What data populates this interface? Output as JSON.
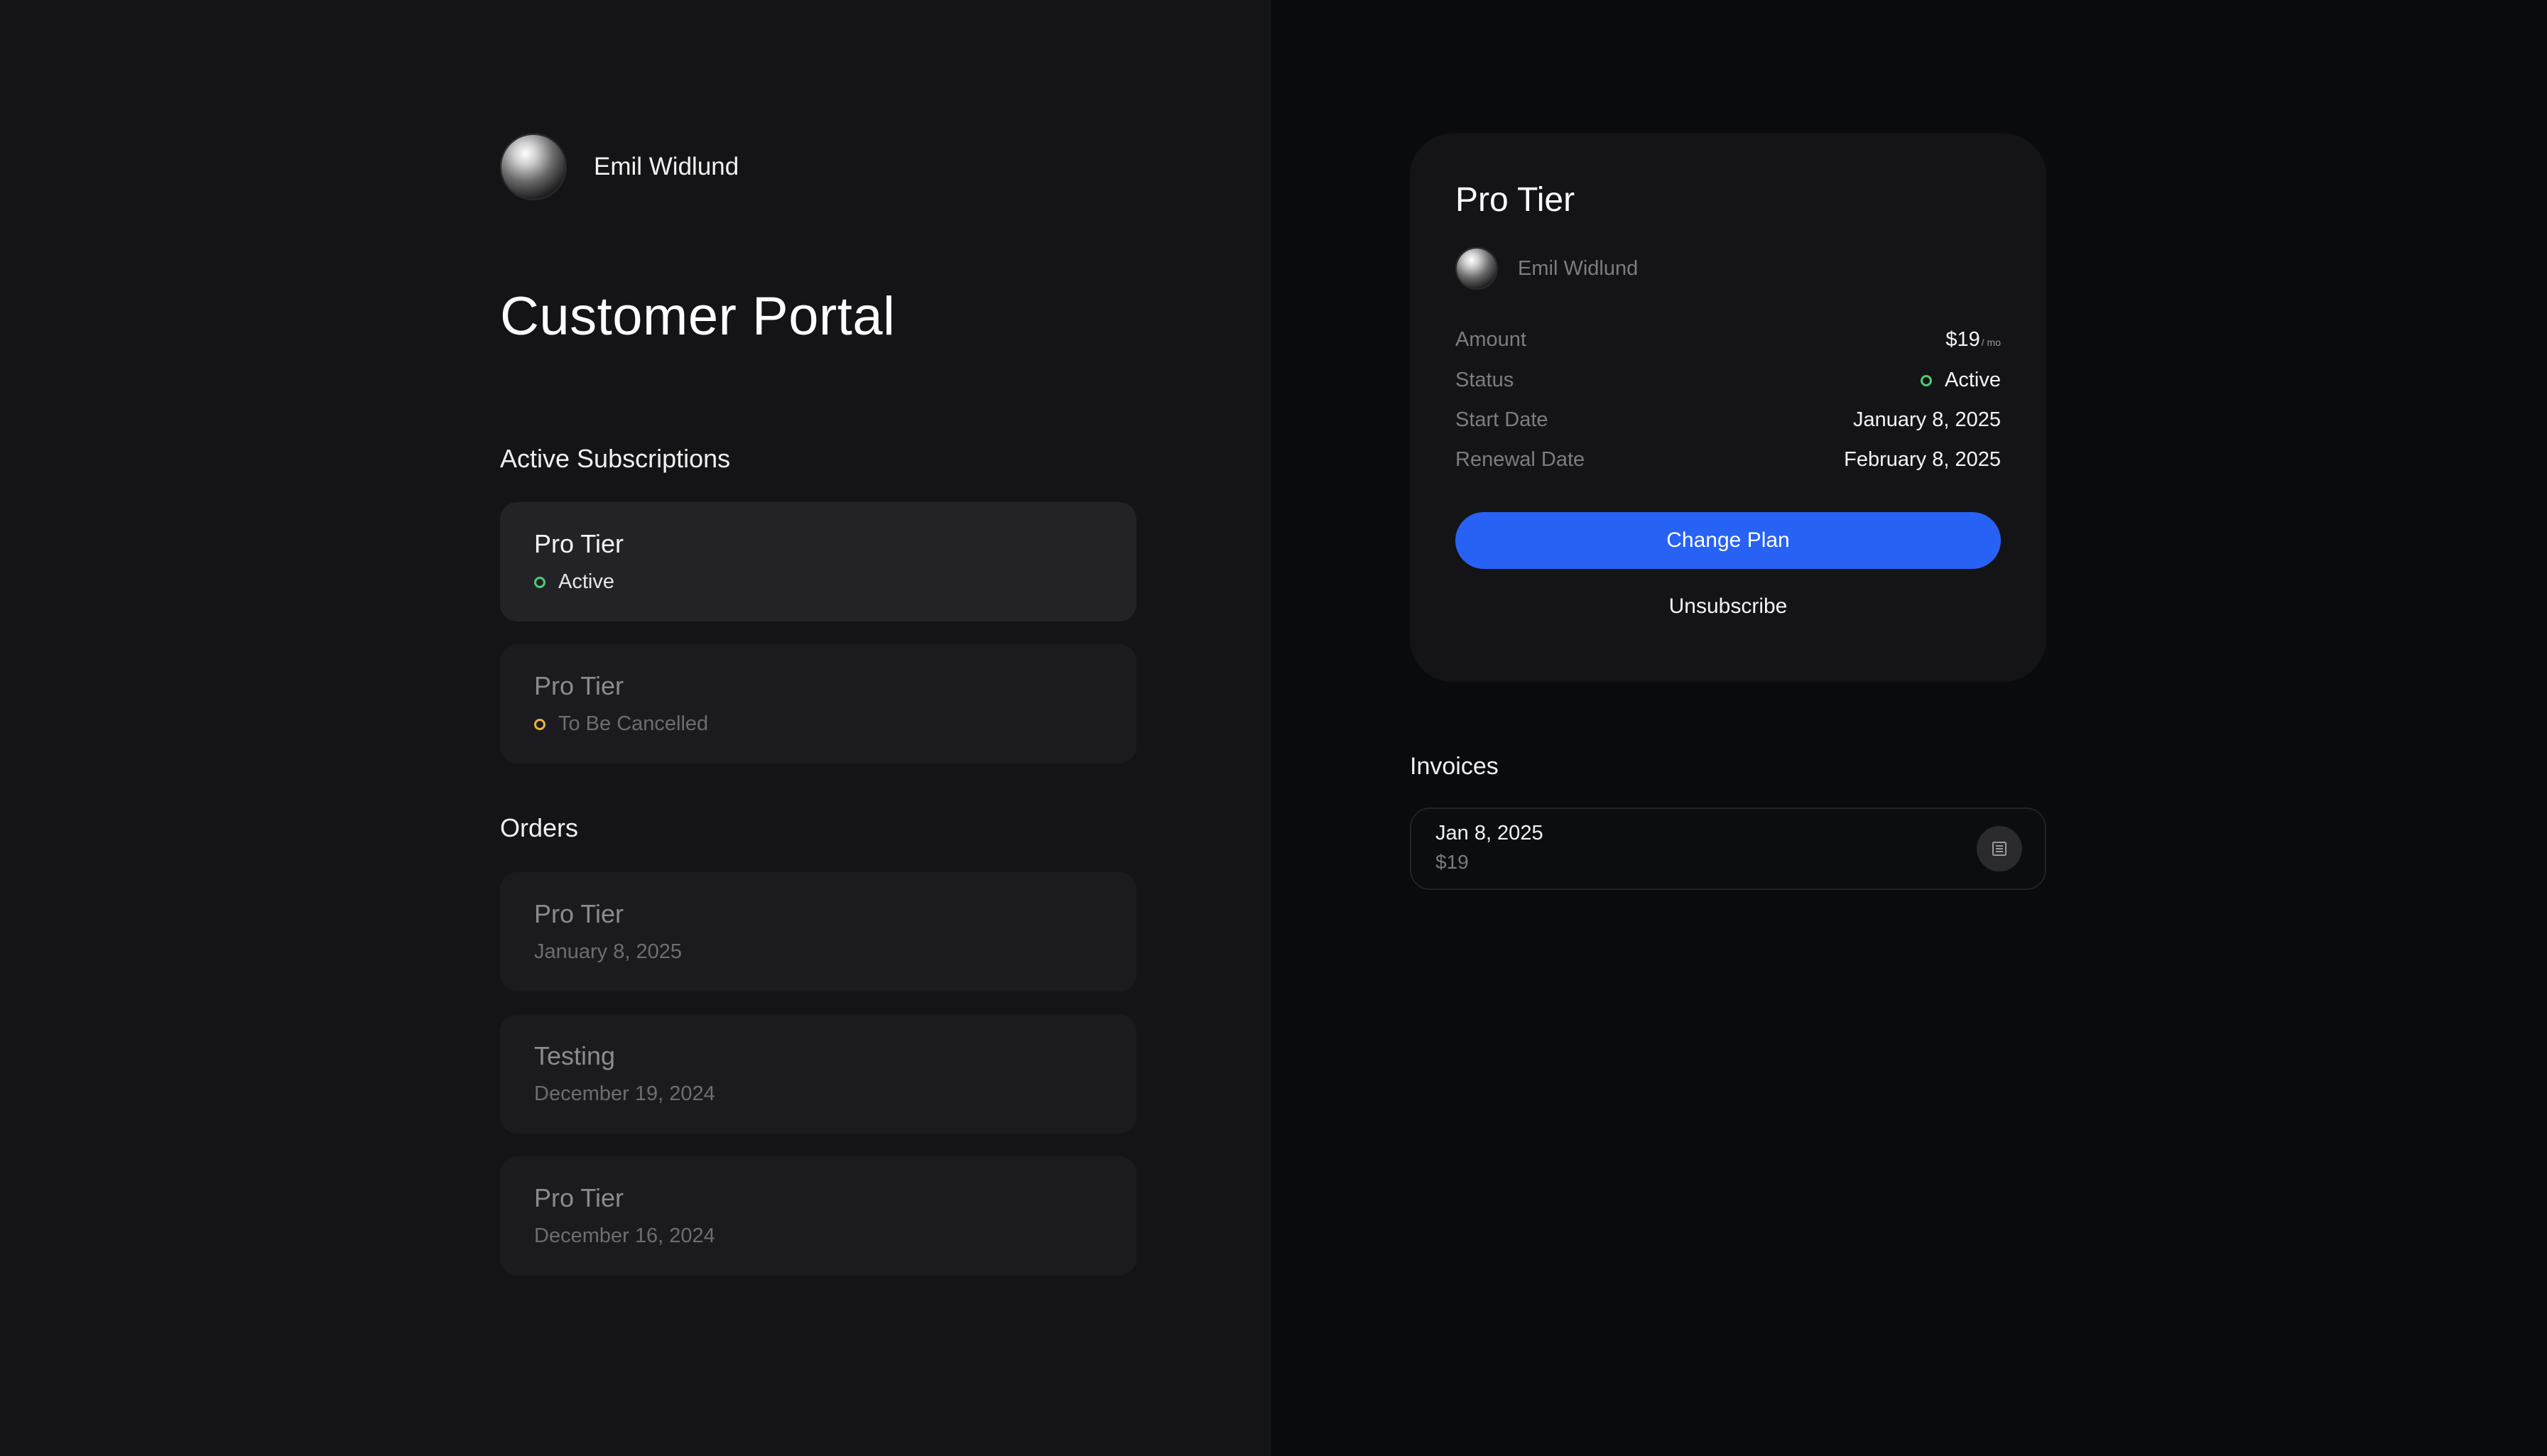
{
  "user": {
    "name": "Emil Widlund"
  },
  "page_title": "Customer Portal",
  "subscriptions": {
    "heading": "Active Subscriptions",
    "items": [
      {
        "title": "Pro Tier",
        "status": "Active"
      },
      {
        "title": "Pro Tier",
        "status": "To Be Cancelled"
      }
    ]
  },
  "orders": {
    "heading": "Orders",
    "items": [
      {
        "title": "Pro Tier",
        "date": "January 8, 2025"
      },
      {
        "title": "Testing",
        "date": "December 19, 2024"
      },
      {
        "title": "Pro Tier",
        "date": "December 16, 2024"
      }
    ]
  },
  "detail": {
    "title": "Pro Tier",
    "user_name": "Emil Widlund",
    "amount_label": "Amount",
    "amount_value": "$19",
    "amount_period": "/ mo",
    "status_label": "Status",
    "status_value": "Active",
    "start_label": "Start Date",
    "start_value": "January 8, 2025",
    "renewal_label": "Renewal Date",
    "renewal_value": "February 8, 2025",
    "change_plan_label": "Change Plan",
    "unsubscribe_label": "Unsubscribe"
  },
  "invoices": {
    "heading": "Invoices",
    "items": [
      {
        "date": "Jan 8, 2025",
        "amount": "$19",
        "icon": "receipt-icon"
      }
    ]
  },
  "colors": {
    "accent": "#2762f5",
    "status_active": "#4ecb71",
    "status_cancelled": "#e8b33c"
  }
}
